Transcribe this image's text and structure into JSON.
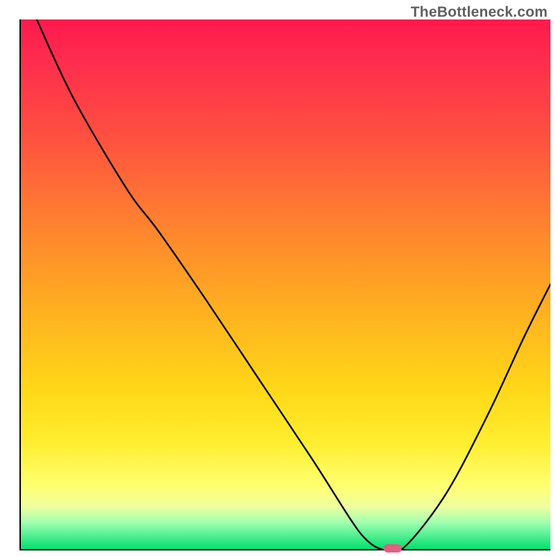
{
  "watermark": "TheBottleneck.com",
  "chart_data": {
    "type": "line",
    "title": "",
    "xlabel": "",
    "ylabel": "",
    "xlim": [
      0,
      100
    ],
    "ylim": [
      0,
      100
    ],
    "grid": false,
    "legend": false,
    "background": "vertical-gradient red→orange→yellow→green",
    "series": [
      {
        "name": "bottleneck-curve",
        "color": "#000000",
        "x": [
          3,
          10,
          20,
          26,
          35,
          45,
          55,
          62,
          65,
          68,
          72,
          80,
          88,
          95,
          100
        ],
        "y": [
          100,
          85,
          68,
          60,
          47,
          32,
          17,
          6,
          2,
          0,
          0,
          10,
          25,
          40,
          50
        ]
      }
    ],
    "marker": {
      "x": 70,
      "y": 0,
      "color": "#e06080"
    }
  }
}
